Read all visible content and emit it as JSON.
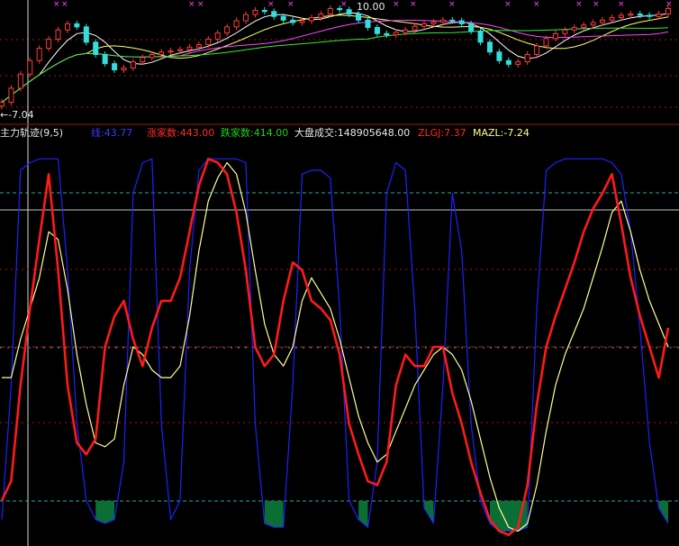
{
  "price_panel": {
    "high_label": "10.00",
    "low_label": "←-7.04",
    "marker_text": "×"
  },
  "indicator_header": {
    "name": "主力轨迹(9,5)",
    "items": [
      {
        "label": "线:43.77",
        "color": "#3a3aff"
      },
      {
        "label": "涨家数:443.00",
        "color": "#ff2a2a"
      },
      {
        "label": "跌家数:414.00",
        "color": "#22cc22"
      },
      {
        "label": "大盘成交:148905648.00",
        "color": "#e8e8e8"
      },
      {
        "label": "ZLGJ:7.37",
        "color": "#ff2a2a"
      },
      {
        "label": "MAZL:-7.24",
        "color": "#ffff88"
      }
    ]
  },
  "colors": {
    "background": "#000000",
    "up_candle": "#ff3b3b",
    "down_candle": "#33dddd",
    "ma1": "#ffffff",
    "ma2": "#ffff66",
    "ma3": "#ff44ff",
    "ma4": "#33ee33",
    "blue_line": "#2020ff",
    "red_line": "#ff1a1a",
    "yellow_line": "#ffff99",
    "green_fill": "#0b6e35",
    "grid_red": "#a01818",
    "grid_cyan": "#2aa8a8",
    "grid_white": "#c8c8c8"
  },
  "chart_data": [
    {
      "type": "candlestick",
      "title": "",
      "annotations": [
        "10.00",
        "←-7.04"
      ],
      "series": [
        {
          "values": [
            -5.8,
            -3.5,
            -1.2,
            1.0,
            3.0,
            4.5,
            6.0,
            7.0,
            6.5,
            4.0,
            2.0,
            0.5,
            -0.5,
            -0.2,
            0.8,
            1.5,
            2.0,
            2.4,
            2.6,
            2.8,
            3.2,
            3.6,
            4.5,
            5.5,
            6.5,
            7.5,
            8.5,
            9.2,
            9.0,
            8.2,
            7.6,
            7.2,
            7.5,
            8.0,
            8.6,
            9.5,
            9.3,
            8.6,
            7.6,
            6.4,
            5.4,
            5.2,
            5.6,
            6.0,
            6.6,
            7.0,
            7.3,
            7.6,
            7.5,
            7.0,
            5.8,
            4.0,
            2.4,
            1.0,
            0.4,
            0.8,
            2.0,
            3.4,
            4.6,
            5.4,
            6.0,
            6.4,
            6.8,
            7.2,
            7.6,
            8.0,
            8.4,
            8.6,
            8.4,
            8.2,
            8.6,
            9.5
          ]
        }
      ]
    },
    {
      "type": "line",
      "title": "主力轨迹(9,5)",
      "ylim": [
        0,
        100
      ],
      "series": [
        {
          "name": "线",
          "values": [
            5,
            40,
            96,
            98,
            99,
            99,
            99,
            70,
            30,
            10,
            5,
            4,
            5,
            20,
            90,
            98,
            99,
            30,
            5,
            10,
            70,
            96,
            99,
            99,
            99,
            99,
            98,
            30,
            4,
            3,
            3,
            40,
            95,
            96,
            96,
            94,
            60,
            10,
            5,
            3,
            20,
            90,
            98,
            96,
            60,
            8,
            4,
            40,
            90,
            75,
            30,
            10,
            4,
            2,
            2,
            2,
            3,
            60,
            96,
            98,
            99,
            99,
            99,
            99,
            99,
            98,
            95,
            80,
            55,
            25,
            8,
            4
          ]
        },
        {
          "name": "ZLGJ",
          "values": [
            10,
            15,
            40,
            60,
            78,
            95,
            70,
            40,
            25,
            22,
            26,
            50,
            58,
            62,
            52,
            45,
            55,
            62,
            62,
            68,
            80,
            92,
            99,
            98,
            95,
            85,
            70,
            50,
            45,
            48,
            62,
            72,
            70,
            62,
            60,
            57,
            48,
            30,
            22,
            15,
            14,
            20,
            40,
            48,
            45,
            45,
            50,
            50,
            38,
            30,
            20,
            12,
            5,
            2,
            1,
            3,
            14,
            35,
            50,
            58,
            65,
            72,
            80,
            86,
            90,
            95,
            82,
            68,
            58,
            50,
            42,
            55
          ]
        },
        {
          "name": "MAZL",
          "values": [
            42,
            42,
            52,
            60,
            68,
            80,
            78,
            65,
            48,
            35,
            25,
            24,
            26,
            40,
            50,
            48,
            44,
            42,
            42,
            45,
            58,
            75,
            88,
            94,
            98,
            95,
            85,
            70,
            56,
            48,
            45,
            50,
            62,
            68,
            64,
            60,
            52,
            42,
            32,
            25,
            20,
            22,
            28,
            34,
            40,
            44,
            48,
            50,
            48,
            44,
            36,
            26,
            16,
            8,
            3,
            2,
            4,
            14,
            28,
            40,
            48,
            54,
            60,
            68,
            76,
            85,
            88,
            80,
            70,
            62,
            56,
            50
          ]
        }
      ]
    }
  ]
}
